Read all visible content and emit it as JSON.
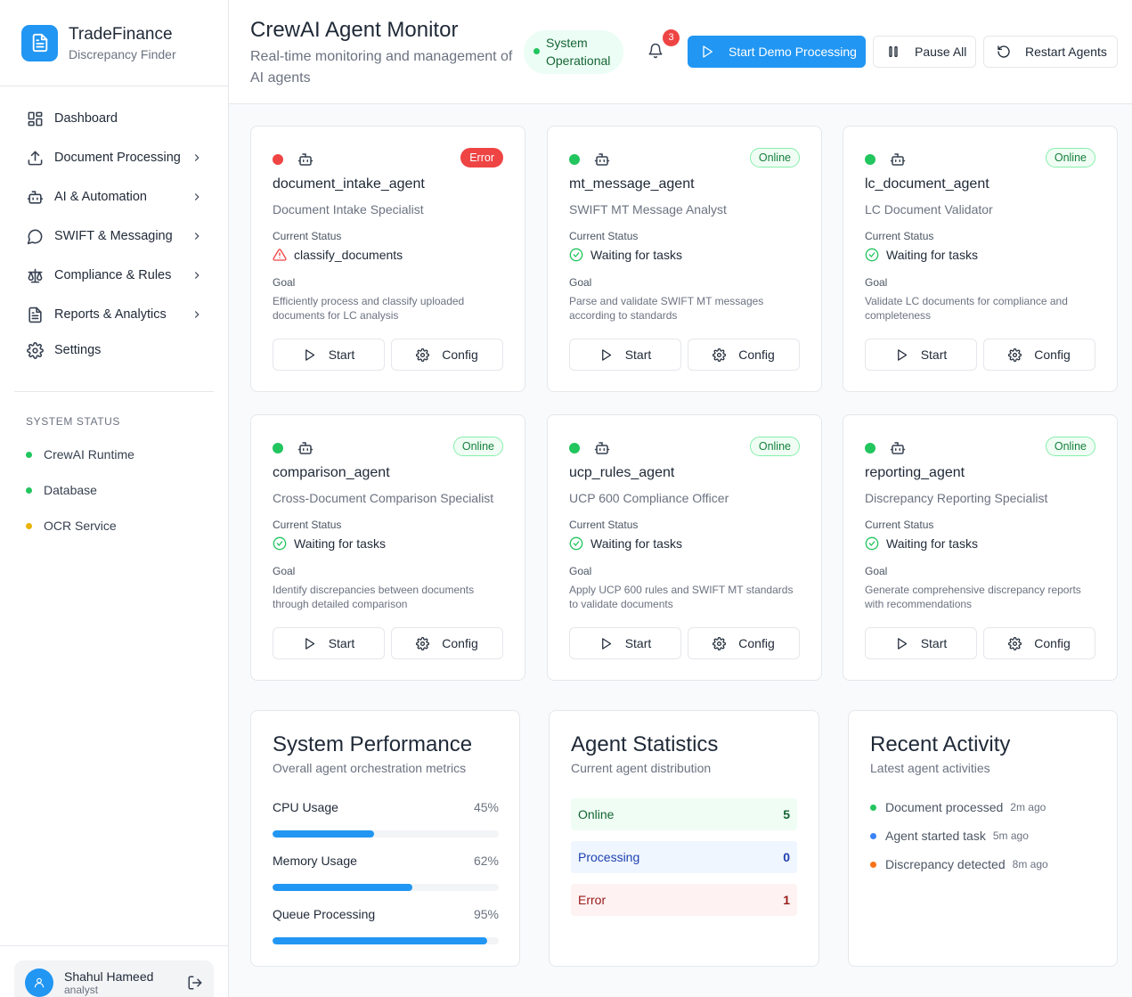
{
  "brand": {
    "name": "TradeFinance",
    "subtitle": "Discrepancy Finder"
  },
  "nav": [
    {
      "label": "Dashboard",
      "icon": "dashboard-icon",
      "chevron": false
    },
    {
      "label": "Document Processing",
      "icon": "upload-icon",
      "chevron": true
    },
    {
      "label": "AI & Automation",
      "icon": "bot-icon",
      "chevron": true
    },
    {
      "label": "SWIFT & Messaging",
      "icon": "message-icon",
      "chevron": true
    },
    {
      "label": "Compliance & Rules",
      "icon": "scale-icon",
      "chevron": true
    },
    {
      "label": "Reports & Analytics",
      "icon": "file-text-icon",
      "chevron": true
    },
    {
      "label": "Settings",
      "icon": "gear-icon",
      "chevron": false
    }
  ],
  "system_status": {
    "title": "SYSTEM STATUS",
    "items": [
      {
        "label": "CrewAI Runtime",
        "color": "#22c55e"
      },
      {
        "label": "Database",
        "color": "#22c55e"
      },
      {
        "label": "OCR Service",
        "color": "#eab308"
      }
    ]
  },
  "user": {
    "name": "Shahul Hameed",
    "role": "analyst"
  },
  "header": {
    "title": "CrewAI Agent Monitor",
    "subtitle": "Real-time monitoring and management of AI agents",
    "system_badge": "System Operational",
    "notification_count": "3",
    "start_demo": "Start Demo Processing",
    "pause_all": "Pause All",
    "restart": "Restart Agents"
  },
  "labels": {
    "current_status": "Current Status",
    "goal": "Goal",
    "start": "Start",
    "config": "Config"
  },
  "agents": [
    {
      "name": "document_intake_agent",
      "role": "Document Intake Specialist",
      "badge": "Error",
      "state": "error",
      "status": "classify_documents",
      "goal": "Efficiently process and classify uploaded documents for LC analysis"
    },
    {
      "name": "mt_message_agent",
      "role": "SWIFT MT Message Analyst",
      "badge": "Online",
      "state": "online",
      "status": "Waiting for tasks",
      "goal": "Parse and validate SWIFT MT messages according to standards"
    },
    {
      "name": "lc_document_agent",
      "role": "LC Document Validator",
      "badge": "Online",
      "state": "online",
      "status": "Waiting for tasks",
      "goal": "Validate LC documents for compliance and completeness"
    },
    {
      "name": "comparison_agent",
      "role": "Cross-Document Comparison Specialist",
      "badge": "Online",
      "state": "online",
      "status": "Waiting for tasks",
      "goal": "Identify discrepancies between documents through detailed comparison"
    },
    {
      "name": "ucp_rules_agent",
      "role": "UCP 600 Compliance Officer",
      "badge": "Online",
      "state": "online",
      "status": "Waiting for tasks",
      "goal": "Apply UCP 600 rules and SWIFT MT standards to validate documents"
    },
    {
      "name": "reporting_agent",
      "role": "Discrepancy Reporting Specialist",
      "badge": "Online",
      "state": "online",
      "status": "Waiting for tasks",
      "goal": "Generate comprehensive discrepancy reports with recommendations"
    }
  ],
  "performance": {
    "title": "System Performance",
    "subtitle": "Overall agent orchestration metrics",
    "metrics": [
      {
        "label": "CPU Usage",
        "value": "45%",
        "fraction": 0.45
      },
      {
        "label": "Memory Usage",
        "value": "62%",
        "fraction": 0.62
      },
      {
        "label": "Queue Processing",
        "value": "95%",
        "fraction": 0.95
      }
    ]
  },
  "statistics": {
    "title": "Agent Statistics",
    "subtitle": "Current agent distribution",
    "rows": [
      {
        "label": "Online",
        "value": "5",
        "bg": "#f0fdf4",
        "fg": "#166534"
      },
      {
        "label": "Processing",
        "value": "0",
        "bg": "#eff6ff",
        "fg": "#1e40af"
      },
      {
        "label": "Error",
        "value": "1",
        "bg": "#fef2f2",
        "fg": "#991b1b"
      }
    ]
  },
  "activity": {
    "title": "Recent Activity",
    "subtitle": "Latest agent activities",
    "items": [
      {
        "text": "Document processed",
        "time": "2m ago",
        "color": "#22c55e"
      },
      {
        "text": "Agent started task",
        "time": "5m ago",
        "color": "#3b82f6"
      },
      {
        "text": "Discrepancy detected",
        "time": "8m ago",
        "color": "#f97316"
      }
    ]
  }
}
